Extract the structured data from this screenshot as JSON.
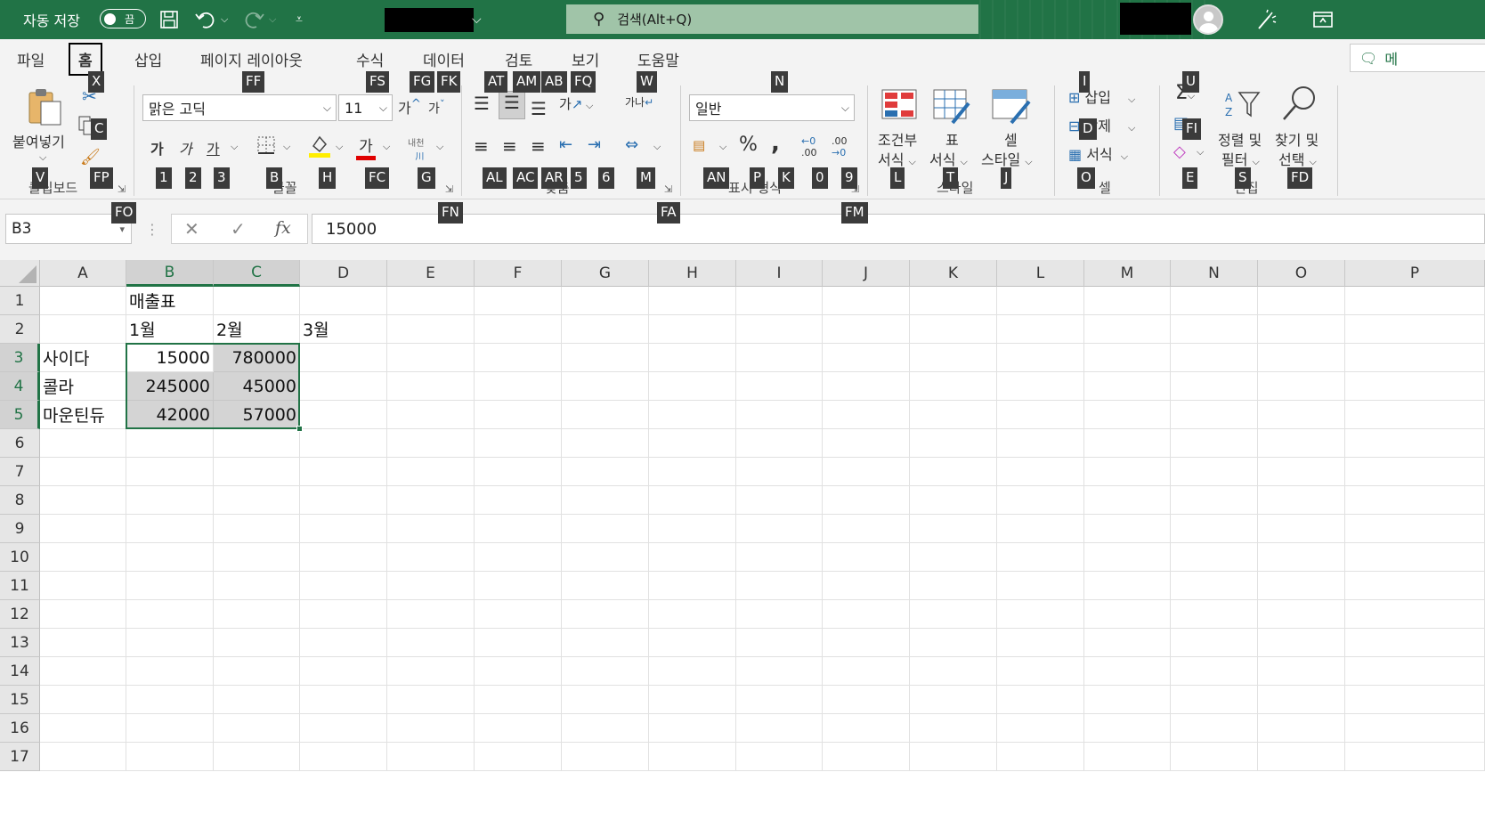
{
  "titlebar": {
    "autosave_label": "자동 저장",
    "autosave_state": "끔",
    "search_placeholder": "검색(Alt+Q)"
  },
  "tabs": [
    {
      "label": "파일"
    },
    {
      "label": "홈",
      "active": true
    },
    {
      "label": "삽입"
    },
    {
      "label": "페이지 레이아웃"
    },
    {
      "label": "수식"
    },
    {
      "label": "데이터"
    },
    {
      "label": "검토"
    },
    {
      "label": "보기"
    },
    {
      "label": "도움말"
    }
  ],
  "share_label": "메",
  "ribbon": {
    "clipboard": {
      "paste_label": "붙여넣기",
      "group_label": "클립보드"
    },
    "font": {
      "font_name": "맑은 고딕",
      "font_size": "11",
      "bold": "가",
      "italic": "가",
      "underline": "가",
      "font_color_glyph": "가",
      "grow": "가",
      "shrink": "가",
      "phonetic": "내천",
      "group_label": "글꼴"
    },
    "alignment": {
      "group_label": "맞춤",
      "orientation_glyph": "가",
      "wrap_glyph": "가나"
    },
    "number": {
      "format": "일반",
      "percent": "%",
      "comma": ",",
      "inc_decimal": ".00",
      "dec_decimal": ".00",
      "group_label": "표시 형식"
    },
    "styles": {
      "conditional_l1": "조건부",
      "conditional_l2": "서식",
      "table_l1": "표",
      "table_l2": "서식",
      "cell_l1": "셀",
      "cell_l2": "스타일",
      "group_label": "스타일"
    },
    "cells": {
      "insert": "삽입",
      "delete": "삭제",
      "format": "서식",
      "group_label": "셀"
    },
    "editing": {
      "sum_glyph": "Σ",
      "sort_l1": "정렬 및",
      "sort_l2": "필터",
      "find_l1": "찾기 및",
      "find_l2": "선택",
      "group_label": "편집"
    }
  },
  "keytips": [
    "X",
    "FF",
    "FS",
    "FG",
    "FK",
    "AT",
    "AM",
    "AB",
    "FQ",
    "W",
    "N",
    "I",
    "U",
    "C",
    "FI",
    "D",
    "V",
    "FP",
    "1",
    "2",
    "3",
    "B",
    "H",
    "FC",
    "G",
    "AL",
    "AC",
    "AR",
    "5",
    "6",
    "M",
    "AN",
    "P",
    "K",
    "0",
    "9",
    "L",
    "T",
    "J",
    "O",
    "E",
    "S",
    "FD",
    "FO",
    "FN",
    "FA",
    "FM"
  ],
  "formula_bar": {
    "name_box": "B3",
    "cancel": "✕",
    "enter": "✓",
    "fx": "fx",
    "value": "15000"
  },
  "columns": [
    "A",
    "B",
    "C",
    "D",
    "E",
    "F",
    "G",
    "H",
    "I",
    "J",
    "K",
    "L",
    "M",
    "N",
    "O",
    "P"
  ],
  "rows": [
    "1",
    "2",
    "3",
    "4",
    "5",
    "6",
    "7",
    "8",
    "9",
    "10",
    "11",
    "12",
    "13",
    "14",
    "15",
    "16",
    "17"
  ],
  "sheet": {
    "title": "매출표",
    "months": [
      "1월",
      "2월",
      "3월"
    ],
    "products": [
      {
        "name": "사이다",
        "values": [
          "15000",
          "780000"
        ]
      },
      {
        "name": "콜라",
        "values": [
          "245000",
          "45000"
        ]
      },
      {
        "name": "마운틴듀",
        "values": [
          "42000",
          "57000"
        ]
      }
    ]
  },
  "colors": {
    "brand": "#217346",
    "selection_fill": "#d4d4d4"
  }
}
